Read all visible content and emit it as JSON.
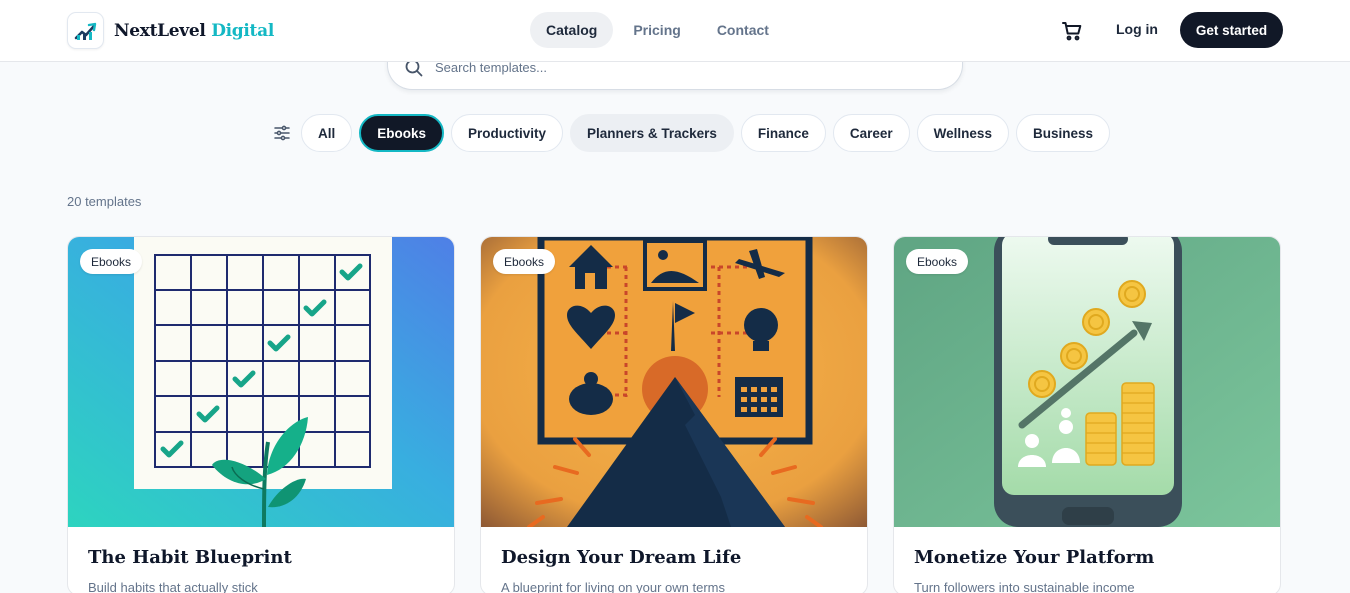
{
  "brand": {
    "name_main": "NextLevel",
    "name_accent": "Digital",
    "accent_color": "#14b8c4"
  },
  "nav": {
    "items": [
      {
        "label": "Catalog",
        "active": true
      },
      {
        "label": "Pricing",
        "active": false
      },
      {
        "label": "Contact",
        "active": false
      }
    ],
    "cart_icon": "cart-icon",
    "login_label": "Log in",
    "cta_label": "Get started"
  },
  "search": {
    "placeholder": "Search templates...",
    "value": ""
  },
  "filters": {
    "icon": "sliders-icon",
    "chips": [
      {
        "label": "All"
      },
      {
        "label": "Ebooks",
        "active": true
      },
      {
        "label": "Productivity"
      },
      {
        "label": "Planners & Trackers"
      },
      {
        "label": "Finance"
      },
      {
        "label": "Career"
      },
      {
        "label": "Wellness"
      },
      {
        "label": "Business"
      }
    ]
  },
  "results": {
    "count_label": "20 templates"
  },
  "cards": [
    {
      "badge": "Ebooks",
      "title": "The Habit Blueprint",
      "desc": "Build habits that actually stick"
    },
    {
      "badge": "Ebooks",
      "title": "Design Your Dream Life",
      "desc": "A blueprint for living on your own terms"
    },
    {
      "badge": "Ebooks",
      "title": "Monetize Your Platform",
      "desc": "Turn followers into sustainable income"
    }
  ]
}
